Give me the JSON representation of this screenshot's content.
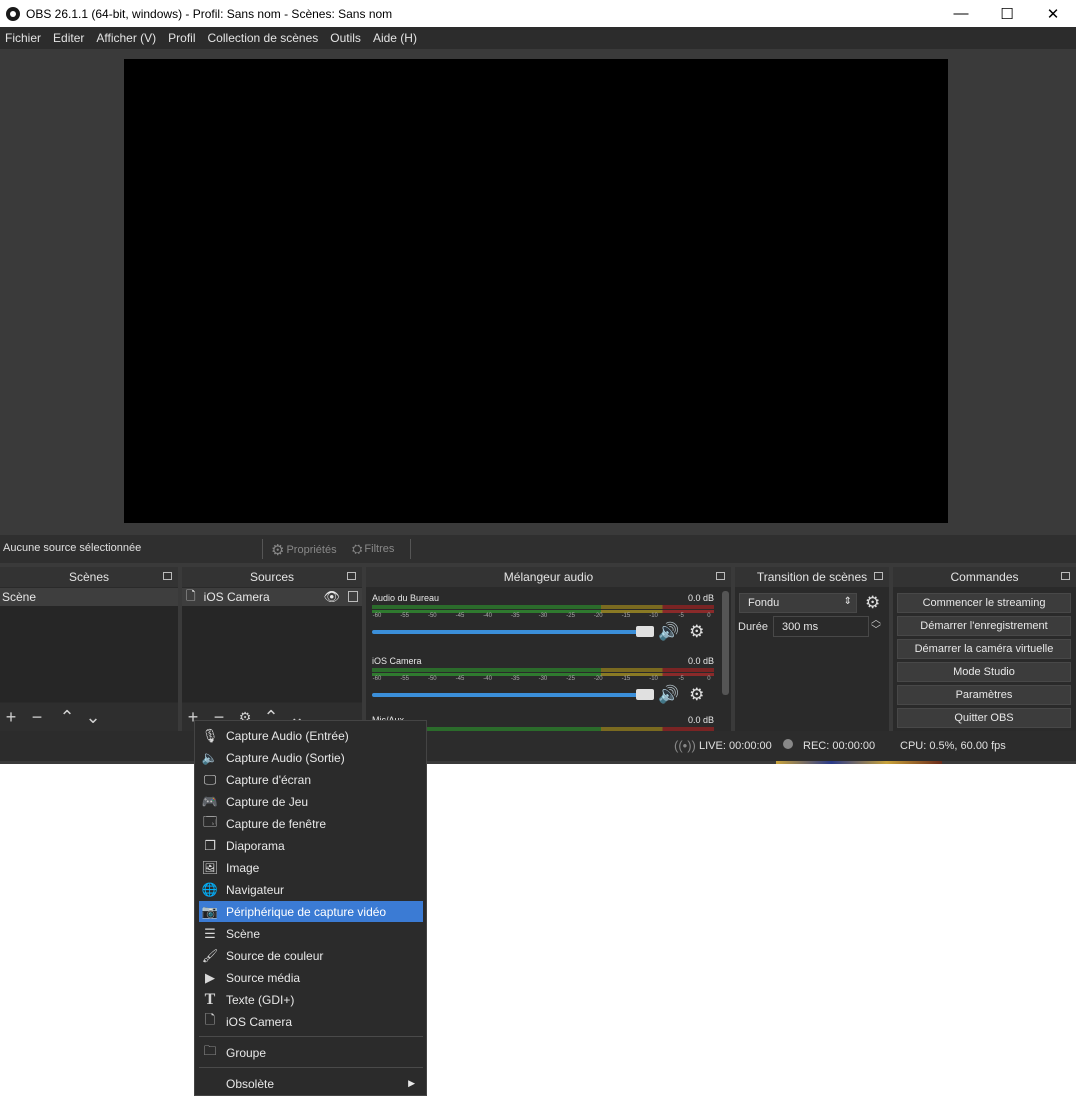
{
  "window": {
    "title": "OBS 26.1.1 (64-bit, windows) - Profil: Sans nom - Scènes: Sans nom",
    "controls": {
      "minimize": "—",
      "maximize": "☐",
      "close": "✕"
    }
  },
  "menu": [
    "Fichier",
    "Editer",
    "Afficher (V)",
    "Profil",
    "Collection de scènes",
    "Outils",
    "Aide (H)"
  ],
  "source_bar": {
    "no_selection": "Aucune source sélectionnée",
    "properties": "Propriétés",
    "filters": "Filtres"
  },
  "scenes": {
    "title": "Scènes",
    "items": [
      "Scène"
    ]
  },
  "sources": {
    "title": "Sources",
    "items": [
      "iOS Camera"
    ]
  },
  "mixer": {
    "title": "Mélangeur audio",
    "ticks": [
      "-60",
      "-55",
      "-50",
      "-45",
      "-40",
      "-35",
      "-30",
      "-25",
      "-20",
      "-15",
      "-10",
      "-5",
      "0"
    ],
    "channels": [
      {
        "name": "Audio du Bureau",
        "db": "0.0 dB"
      },
      {
        "name": "iOS Camera",
        "db": "0.0 dB"
      },
      {
        "name": "Mic/Aux",
        "db": "0.0 dB"
      }
    ]
  },
  "transitions": {
    "title": "Transition de scènes",
    "selected": "Fondu",
    "duration_label": "Durée",
    "duration_value": "300 ms"
  },
  "commands": {
    "title": "Commandes",
    "buttons": [
      "Commencer le streaming",
      "Démarrer l'enregistrement",
      "Démarrer la caméra virtuelle",
      "Mode Studio",
      "Paramètres",
      "Quitter OBS"
    ]
  },
  "status": {
    "live": "LIVE: 00:00:00",
    "rec": "REC: 00:00:00",
    "cpu": "CPU: 0.5%, 60.00 fps"
  },
  "context_menu": {
    "items": [
      {
        "label": "Capture Audio (Entrée)",
        "icon": "microphone-icon"
      },
      {
        "label": "Capture Audio (Sortie)",
        "icon": "speaker-icon"
      },
      {
        "label": "Capture d'écran",
        "icon": "monitor-icon"
      },
      {
        "label": "Capture de Jeu",
        "icon": "gamepad-icon"
      },
      {
        "label": "Capture de fenêtre",
        "icon": "window-icon"
      },
      {
        "label": "Diaporama",
        "icon": "slideshow-icon"
      },
      {
        "label": "Image",
        "icon": "image-icon"
      },
      {
        "label": "Navigateur",
        "icon": "globe-icon"
      },
      {
        "label": "Périphérique de capture vidéo",
        "icon": "camera-icon",
        "highlighted": true
      },
      {
        "label": "Scène",
        "icon": "list-icon"
      },
      {
        "label": "Source de couleur",
        "icon": "brush-icon"
      },
      {
        "label": "Source média",
        "icon": "play-icon"
      },
      {
        "label": "Texte (GDI+)",
        "icon": "text-icon"
      },
      {
        "label": "iOS Camera",
        "icon": "file-icon"
      }
    ],
    "group": "Groupe",
    "obsolete": "Obsolète"
  }
}
